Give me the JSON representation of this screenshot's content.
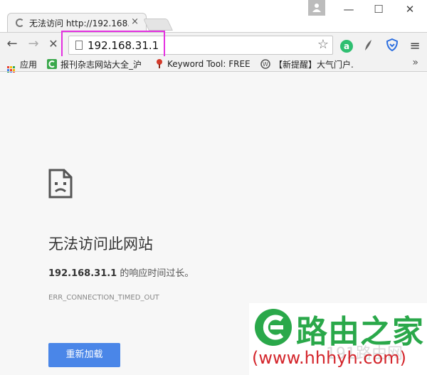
{
  "tab": {
    "title": "无法访问 http://192.168.",
    "close": "×"
  },
  "window": {
    "minimize": "—",
    "maximize": "☐",
    "close": "✕"
  },
  "toolbar": {
    "back": "←",
    "forward": "→",
    "stop": "✕",
    "url": "192.168.31.1",
    "star": "☆",
    "menu": "≡"
  },
  "bookmarks": {
    "items": [
      {
        "label": "应用"
      },
      {
        "label": "报刊杂志网站大全_沪"
      },
      {
        "label": "Keyword Tool: FREE"
      },
      {
        "label": "【新提醒】大气门户."
      }
    ],
    "more": "»"
  },
  "error": {
    "title": "无法访问此网站",
    "host": "192.168.31.1",
    "message": " 的响应时间过长。",
    "code": "ERR_CONNECTION_TIMED_OUT",
    "reload": "重新加载"
  },
  "watermark": {
    "title": "路由之家",
    "url": "(www.hhhyh.com)",
    "faint": "191路由网"
  },
  "colors": {
    "accent": "#4a86e8",
    "highlight": "#e430e0",
    "watermark_green": "#2aa84a",
    "watermark_red": "#d4262c"
  }
}
